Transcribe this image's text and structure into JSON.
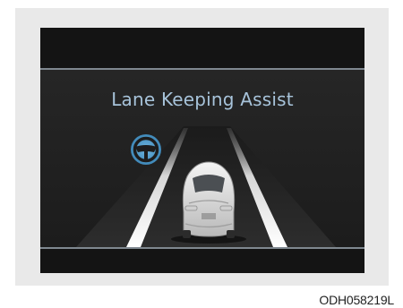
{
  "display": {
    "title": "Lane Keeping Assist",
    "icons": [
      "steering-wheel-icon"
    ],
    "colors": {
      "screen_background": "#1a1a1a",
      "title_text": "#a7c3da",
      "divider_line": "#7f8890",
      "lane_marking": "#f2f2f2",
      "steering_icon": "#5aa7d6",
      "vehicle_body": "#e6e6e6"
    }
  },
  "caption": {
    "code": "ODH058219L"
  }
}
